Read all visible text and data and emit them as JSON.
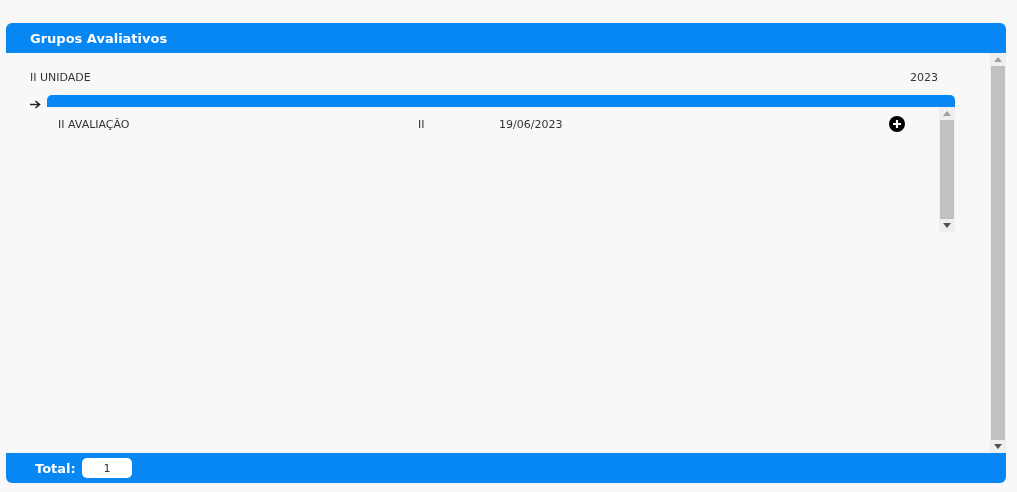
{
  "panel": {
    "title": "Grupos Avaliativos"
  },
  "unit": {
    "name": "II UNIDADE",
    "year": "2023"
  },
  "evaluations": [
    {
      "name": "II AVALIAÇÃO",
      "code": "II",
      "date": "19/06/2023"
    }
  ],
  "footer": {
    "label": "Total:",
    "value": "1"
  }
}
